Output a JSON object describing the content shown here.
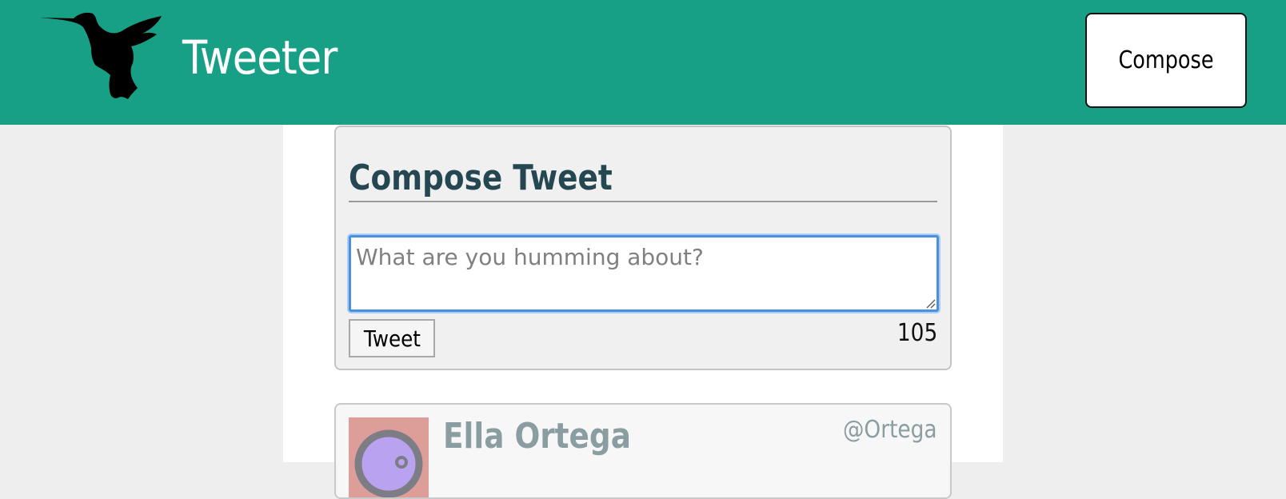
{
  "header": {
    "logo_icon": "hummingbird-icon",
    "brand": "Tweeter",
    "compose_label": "Compose",
    "background_color": "#18a087"
  },
  "compose": {
    "title": "Compose Tweet",
    "input_placeholder": "What are you humming about?",
    "input_value": "",
    "tweet_label": "Tweet",
    "char_count": "105"
  },
  "tweets": [
    {
      "author_name": "Ella Ortega",
      "handle": "@Ortega",
      "avatar_icon": "avatar-icon"
    }
  ]
}
